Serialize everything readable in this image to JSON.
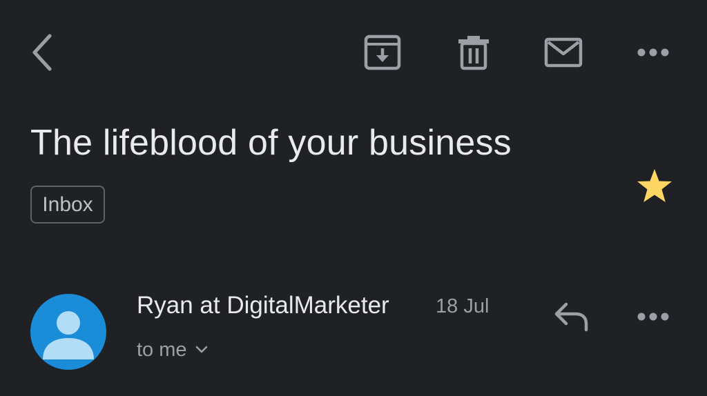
{
  "toolbar": {
    "back_icon": "chevron-left-icon",
    "archive_icon": "archive-icon",
    "delete_icon": "trash-icon",
    "mark_unread_icon": "mail-icon",
    "more_icon": "more-horizontal-icon"
  },
  "email": {
    "subject": "The lifeblood of your business",
    "label": "Inbox",
    "starred": true,
    "star_color": "#fdd663"
  },
  "message": {
    "sender": "Ryan at DigitalMarketer",
    "date": "18 Jul",
    "recipient": "to me",
    "avatar_color": "#1a8cd8",
    "reply_icon": "reply-icon",
    "more_icon": "more-horizontal-icon"
  },
  "colors": {
    "background": "#202124",
    "text_primary": "#e8eaed",
    "text_secondary": "#9aa0a6",
    "icon": "#9aa0a6"
  }
}
